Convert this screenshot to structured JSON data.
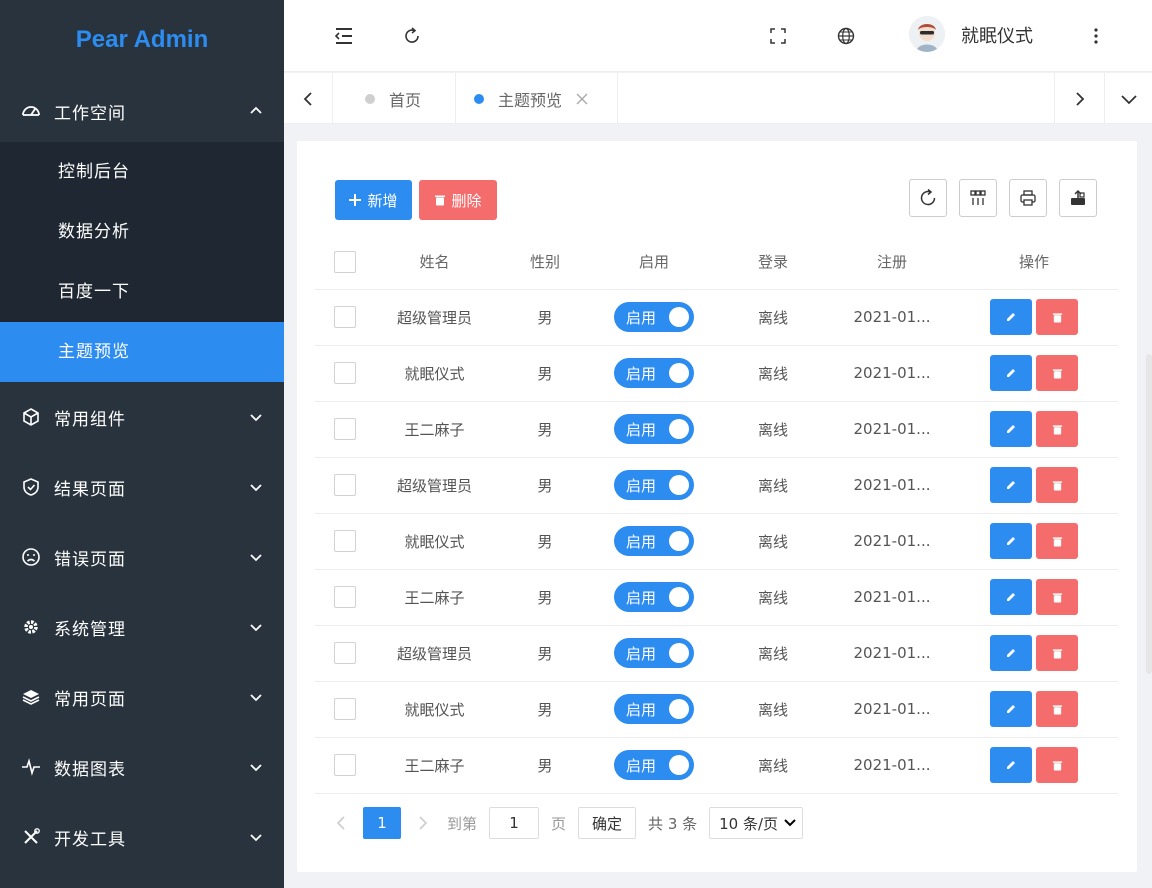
{
  "app": {
    "title": "Pear Admin"
  },
  "sidebar": {
    "workspace": {
      "label": "工作空间",
      "icon": "dashboard-icon",
      "children": [
        {
          "label": "控制后台",
          "active": false
        },
        {
          "label": "数据分析",
          "active": false
        },
        {
          "label": "百度一下",
          "active": false
        },
        {
          "label": "主题预览",
          "active": true
        }
      ]
    },
    "items": [
      {
        "label": "常用组件",
        "icon": "cube-icon"
      },
      {
        "label": "结果页面",
        "icon": "shield-check-icon"
      },
      {
        "label": "错误页面",
        "icon": "sad-face-icon"
      },
      {
        "label": "系统管理",
        "icon": "gear-icon"
      },
      {
        "label": "常用页面",
        "icon": "layers-icon"
      },
      {
        "label": "数据图表",
        "icon": "pulse-icon"
      },
      {
        "label": "开发工具",
        "icon": "tools-icon"
      }
    ]
  },
  "header": {
    "user_name": "就眠仪式",
    "icons": [
      "menu-fold-icon",
      "refresh-icon",
      "fullscreen-icon",
      "globe-icon",
      "more-vertical-icon"
    ]
  },
  "tabs": [
    {
      "label": "首页",
      "active": false,
      "closable": false
    },
    {
      "label": "主题预览",
      "active": true,
      "closable": true
    }
  ],
  "toolbar": {
    "add_label": "新增",
    "delete_label": "删除",
    "add_color": "#2d8cf0",
    "delete_color": "#f56c6c"
  },
  "table": {
    "columns": [
      "姓名",
      "性别",
      "启用",
      "登录",
      "注册",
      "操作"
    ],
    "rows": [
      {
        "name": "超级管理员",
        "gender": "男",
        "enabled": "启用",
        "login": "离线",
        "registered": "2021-01..."
      },
      {
        "name": "就眠仪式",
        "gender": "男",
        "enabled": "启用",
        "login": "离线",
        "registered": "2021-01..."
      },
      {
        "name": "王二麻子",
        "gender": "男",
        "enabled": "启用",
        "login": "离线",
        "registered": "2021-01..."
      },
      {
        "name": "超级管理员",
        "gender": "男",
        "enabled": "启用",
        "login": "离线",
        "registered": "2021-01..."
      },
      {
        "name": "就眠仪式",
        "gender": "男",
        "enabled": "启用",
        "login": "离线",
        "registered": "2021-01..."
      },
      {
        "name": "王二麻子",
        "gender": "男",
        "enabled": "启用",
        "login": "离线",
        "registered": "2021-01..."
      },
      {
        "name": "超级管理员",
        "gender": "男",
        "enabled": "启用",
        "login": "离线",
        "registered": "2021-01..."
      },
      {
        "name": "就眠仪式",
        "gender": "男",
        "enabled": "启用",
        "login": "离线",
        "registered": "2021-01..."
      },
      {
        "name": "王二麻子",
        "gender": "男",
        "enabled": "启用",
        "login": "离线",
        "registered": "2021-01..."
      }
    ]
  },
  "pagination": {
    "current_page": "1",
    "goto_prefix": "到第",
    "goto_value": "1",
    "goto_suffix": "页",
    "confirm_label": "确定",
    "total_label": "共 3 条",
    "page_size": "10 条/页"
  },
  "colors": {
    "primary": "#2d8cf0",
    "danger": "#f56c6c",
    "sidebar_bg": "#28333e"
  }
}
